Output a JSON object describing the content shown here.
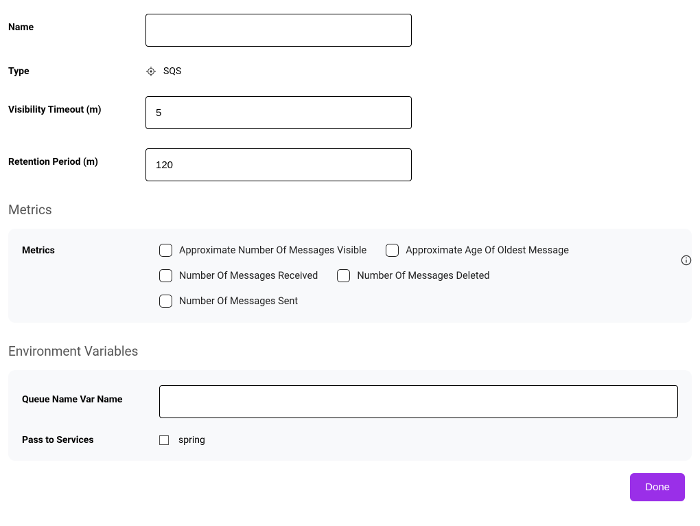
{
  "form": {
    "name": {
      "label": "Name",
      "value": ""
    },
    "type": {
      "label": "Type",
      "value": "SQS"
    },
    "visibility_timeout": {
      "label": "Visibility Timeout (m)",
      "value": "5"
    },
    "retention_period": {
      "label": "Retention Period (m)",
      "value": "120"
    }
  },
  "sections": {
    "metrics_title": "Metrics",
    "env_title": "Environment Variables"
  },
  "metrics": {
    "label": "Metrics",
    "options": {
      "approx_visible": "Approximate Number Of Messages Visible",
      "approx_age": "Approximate Age Of Oldest Message",
      "received": "Number Of Messages Received",
      "deleted": "Number Of Messages Deleted",
      "sent": "Number Of Messages Sent"
    }
  },
  "env": {
    "queue_var_label": "Queue Name Var Name",
    "queue_var_value": "",
    "pass_label": "Pass to Services",
    "pass_option": "spring"
  },
  "footer": {
    "done": "Done"
  }
}
